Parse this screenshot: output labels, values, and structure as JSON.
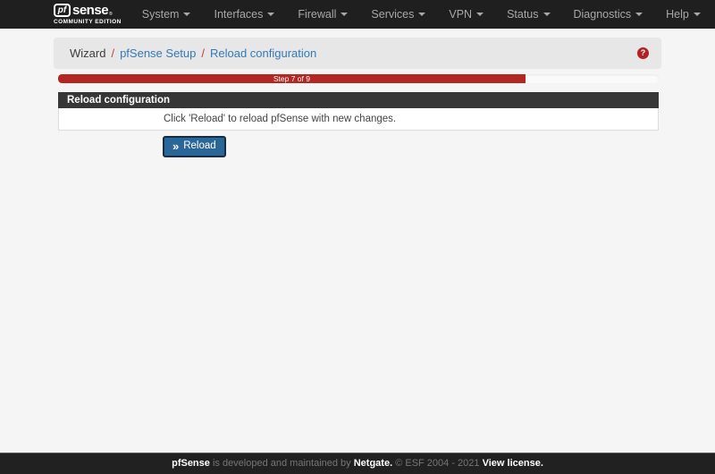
{
  "navbar": {
    "brand": {
      "pf": "pf",
      "sense": "sense",
      "registered": "®",
      "edition": "COMMUNITY EDITION"
    },
    "items": [
      {
        "label": "System"
      },
      {
        "label": "Interfaces"
      },
      {
        "label": "Firewall"
      },
      {
        "label": "Services"
      },
      {
        "label": "VPN"
      },
      {
        "label": "Status"
      },
      {
        "label": "Diagnostics"
      },
      {
        "label": "Help"
      }
    ],
    "icons": {
      "item_caret": "caret-down-icon",
      "logout": "sign-out-icon"
    }
  },
  "breadcrumb": {
    "separator": "/",
    "items": [
      {
        "label": "Wizard"
      },
      {
        "label": "pfSense Setup"
      },
      {
        "label": "Reload configuration"
      }
    ],
    "help_glyph": "?"
  },
  "progress": {
    "label": "Step 7 of 9",
    "step": 7,
    "total_steps": 9,
    "percent": 77.8
  },
  "panel": {
    "title": "Reload configuration",
    "body_text": "Click 'Reload' to reload pfSense with new changes."
  },
  "reload_button": {
    "icon": "»",
    "label": "Reload"
  },
  "footer": {
    "segments": [
      {
        "text": "pfSense",
        "strong": true
      },
      {
        "text": " is developed and maintained by ",
        "strong": false
      },
      {
        "text": "Netgate.",
        "strong": true
      },
      {
        "text": " © ESF 2004 - 2021 ",
        "strong": false
      },
      {
        "text": "View license.",
        "strong": true
      }
    ]
  },
  "colors": {
    "navbar_bg": "#1f1f1f",
    "page_bg": "#f5f5f5",
    "breadcrumb_bg": "#e7e7e7",
    "link_blue": "#337ab7",
    "separator_red": "#b8423e",
    "progress_red": "#b32622",
    "panel_header_bg": "#373737",
    "button_bg": "#2b6699",
    "button_border": "#152c42",
    "help_badge_red": "#b22222",
    "footer_bg": "#212121"
  }
}
